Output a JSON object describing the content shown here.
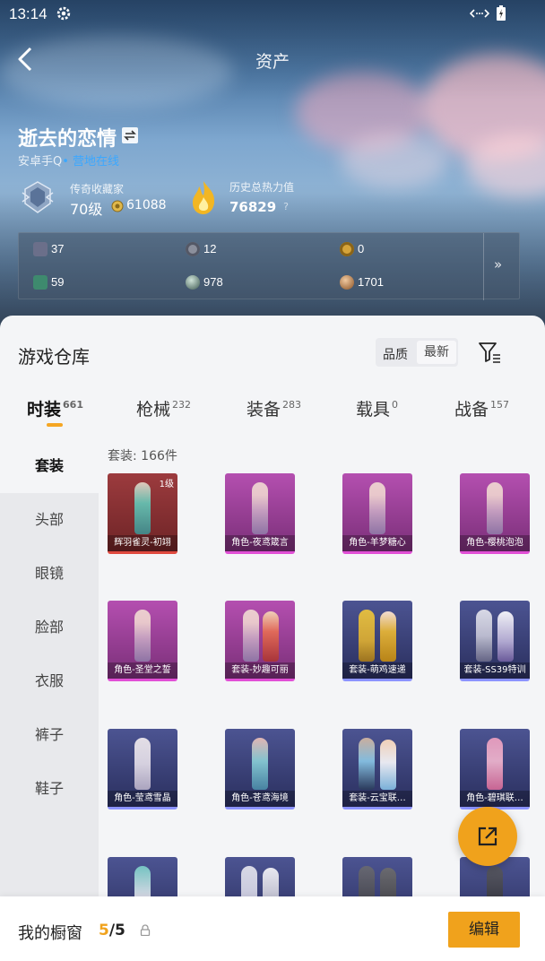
{
  "status_bar": {
    "time": "13:14"
  },
  "nav": {
    "title": "资产"
  },
  "profile": {
    "name": "逝去的恋情",
    "platform": "安卓手Q",
    "status": "• 营地在线",
    "rank_title": "传奇收藏家",
    "level": "70级",
    "coins": "61088",
    "heat_title": "历史总热力值",
    "heat_value": "76829"
  },
  "stats": [
    {
      "icon": "card-icon",
      "value": "37"
    },
    {
      "icon": "chip-icon",
      "value": "12"
    },
    {
      "icon": "badge-icon",
      "value": "0"
    },
    {
      "icon": "gem-icon",
      "value": "59"
    },
    {
      "icon": "orb-icon",
      "value": "978"
    },
    {
      "icon": "bronze-icon",
      "value": "1701"
    }
  ],
  "warehouse": {
    "title": "游戏仓库",
    "sort_label": "品质",
    "sort_value": "最新"
  },
  "tabs": [
    {
      "label": "时装",
      "count": "661",
      "active": true
    },
    {
      "label": "枪械",
      "count": "232"
    },
    {
      "label": "装备",
      "count": "283"
    },
    {
      "label": "载具",
      "count": "0"
    },
    {
      "label": "战备",
      "count": "157"
    }
  ],
  "sidebar": [
    {
      "label": "套装",
      "active": true
    },
    {
      "label": "头部"
    },
    {
      "label": "眼镜"
    },
    {
      "label": "脸部"
    },
    {
      "label": "衣服"
    },
    {
      "label": "裤子"
    },
    {
      "label": "鞋子"
    }
  ],
  "grid": {
    "header": "套装: 166件",
    "items": [
      {
        "name": "辉羽雀灵-初翊",
        "rarity": "red",
        "level": "1级"
      },
      {
        "name": "角色-夜鸢箴言",
        "rarity": "purple"
      },
      {
        "name": "角色-羊梦糖心",
        "rarity": "purple"
      },
      {
        "name": "角色-樱桃泡泡",
        "rarity": "purple"
      },
      {
        "name": "角色-圣堂之誓",
        "rarity": "purple"
      },
      {
        "name": "套装-妙趣可丽",
        "rarity": "purple"
      },
      {
        "name": "套装-萌鸡速递",
        "rarity": "blue"
      },
      {
        "name": "套装-SS39特训",
        "rarity": "blue"
      },
      {
        "name": "角色-莹鸢雪晶",
        "rarity": "blue"
      },
      {
        "name": "角色-苍鸢海境",
        "rarity": "blue"
      },
      {
        "name": "套装-云宝联…",
        "rarity": "blue"
      },
      {
        "name": "角色-碧琪联…",
        "rarity": "blue"
      },
      {
        "name": "",
        "rarity": "blue"
      },
      {
        "name": "",
        "rarity": "blue"
      },
      {
        "name": "",
        "rarity": "blue"
      },
      {
        "name": "",
        "rarity": "blue"
      }
    ]
  },
  "bottom": {
    "window_label": "我的橱窗",
    "window_current": "5",
    "window_total": "/5",
    "edit_label": "编辑"
  },
  "colors": {
    "accent": "#f0a21c",
    "online": "#3ba8ff"
  }
}
